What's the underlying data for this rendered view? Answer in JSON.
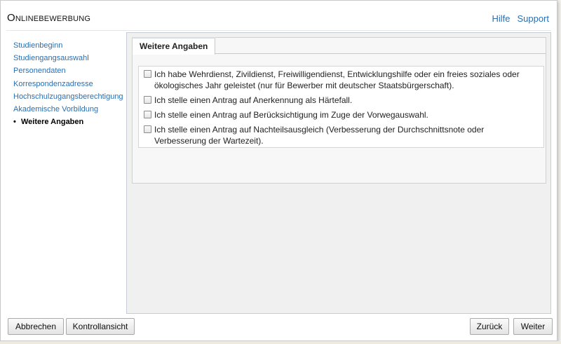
{
  "app": {
    "title": "Onlinebewerbung"
  },
  "top_links": {
    "help": "Hilfe",
    "support": "Support"
  },
  "sidebar": {
    "items": [
      {
        "label": "Studienbeginn",
        "active": false
      },
      {
        "label": "Studiengangsauswahl",
        "active": false
      },
      {
        "label": "Personendaten",
        "active": false
      },
      {
        "label": "Korrespondenzadresse",
        "active": false
      },
      {
        "label": "Hochschulzugangsberechtigung",
        "active": false
      },
      {
        "label": "Akademische Vorbildung",
        "active": false
      },
      {
        "label": "Weitere Angaben",
        "active": true
      }
    ],
    "active_bullet": "•"
  },
  "tab": {
    "label": "Weitere Angaben"
  },
  "checkboxes": [
    {
      "label": "Ich habe Wehrdienst, Zivildienst, Freiwilligendienst, Entwicklungshilfe oder ein freies soziales oder ökologisches Jahr geleistet (nur für Bewerber mit deutscher Staatsbürgerschaft).",
      "checked": false
    },
    {
      "label": "Ich stelle einen Antrag auf Anerkennung als Härtefall.",
      "checked": false
    },
    {
      "label": "Ich stelle einen Antrag auf Berücksichtigung im Zuge der Vorwegauswahl.",
      "checked": false
    },
    {
      "label": "Ich stelle einen Antrag auf Nachteilsausgleich (Verbesserung der Durchschnittsnote oder Verbesserung der Wartezeit).",
      "checked": false
    }
  ],
  "buttons": {
    "cancel": "Abbrechen",
    "review": "Kontrollansicht",
    "back": "Zurück",
    "next": "Weiter"
  }
}
